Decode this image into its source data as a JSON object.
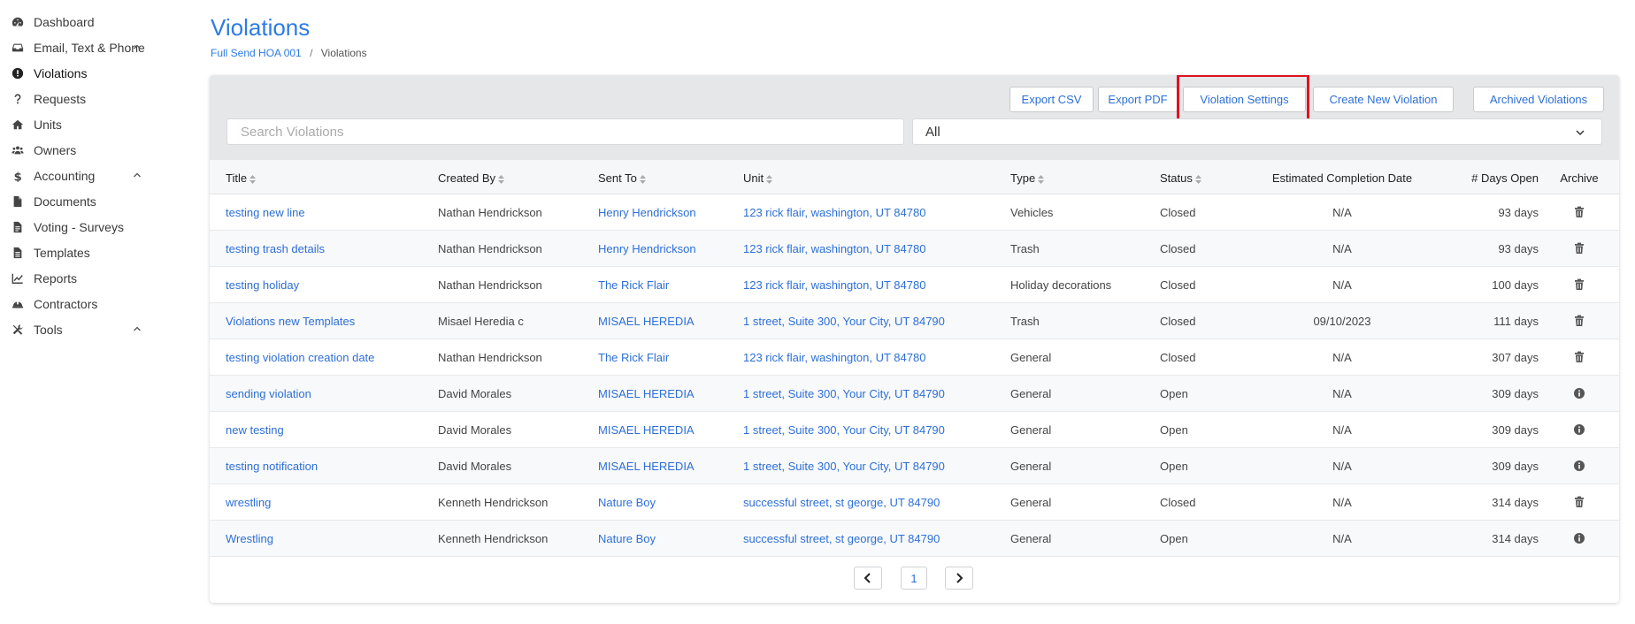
{
  "sidebar": {
    "items": [
      {
        "label": "Dashboard",
        "icon": "dashboard-icon"
      },
      {
        "label": "Email, Text & Phone",
        "icon": "inbox-icon",
        "expandable": true
      },
      {
        "label": "Violations",
        "icon": "exclamation-circle-icon",
        "active": true
      },
      {
        "label": "Requests",
        "icon": "question-icon"
      },
      {
        "label": "Units",
        "icon": "home-icon"
      },
      {
        "label": "Owners",
        "icon": "users-icon"
      },
      {
        "label": "Accounting",
        "icon": "dollar-icon",
        "expandable": true
      },
      {
        "label": "Documents",
        "icon": "file-icon"
      },
      {
        "label": "Voting - Surveys",
        "icon": "file-text-icon"
      },
      {
        "label": "Templates",
        "icon": "file-lines-icon"
      },
      {
        "label": "Reports",
        "icon": "chart-line-icon"
      },
      {
        "label": "Contractors",
        "icon": "hard-hat-icon"
      },
      {
        "label": "Tools",
        "icon": "tools-icon",
        "expandable": true
      }
    ]
  },
  "header": {
    "title": "Violations",
    "breadcrumb": {
      "parent": "Full Send HOA 001",
      "current": "Violations"
    }
  },
  "toolbar": {
    "export_csv": "Export CSV",
    "export_pdf": "Export PDF",
    "violation_settings": "Violation Settings",
    "create_new": "Create New Violation",
    "archived": "Archived Violations",
    "search_placeholder": "Search Violations",
    "filter_value": "All"
  },
  "colors": {
    "accent": "#2d7be5",
    "highlight": "#e0121f"
  },
  "table": {
    "headers": {
      "title": "Title",
      "created_by": "Created By",
      "sent_to": "Sent To",
      "unit": "Unit",
      "type": "Type",
      "status": "Status",
      "est_date": "Estimated Completion Date",
      "days_open": "# Days Open",
      "archive": "Archive"
    },
    "rows": [
      {
        "title": "testing new line",
        "created_by": "Nathan Hendrickson",
        "sent_to": "Henry Hendrickson",
        "unit": "123 rick flair, washington, UT 84780",
        "type": "Vehicles",
        "status": "Closed",
        "est_date": "N/A",
        "days_open": "93 days",
        "archive_icon": "trash-icon"
      },
      {
        "title": "testing trash details",
        "created_by": "Nathan Hendrickson",
        "sent_to": "Henry Hendrickson",
        "unit": "123 rick flair, washington, UT 84780",
        "type": "Trash",
        "status": "Closed",
        "est_date": "N/A",
        "days_open": "93 days",
        "archive_icon": "trash-icon"
      },
      {
        "title": "testing holiday",
        "created_by": "Nathan Hendrickson",
        "sent_to": "The Rick Flair",
        "unit": "123 rick flair, washington, UT 84780",
        "type": "Holiday decorations",
        "status": "Closed",
        "est_date": "N/A",
        "days_open": "100 days",
        "archive_icon": "trash-icon"
      },
      {
        "title": "Violations new Templates",
        "created_by": "Misael Heredia c",
        "sent_to": "MISAEL HEREDIA",
        "unit": "1 street, Suite 300, Your City, UT 84790",
        "type": "Trash",
        "status": "Closed",
        "est_date": "09/10/2023",
        "days_open": "111 days",
        "archive_icon": "trash-icon"
      },
      {
        "title": "testing violation creation date",
        "created_by": "Nathan Hendrickson",
        "sent_to": "The Rick Flair",
        "unit": "123 rick flair, washington, UT 84780",
        "type": "General",
        "status": "Closed",
        "est_date": "N/A",
        "days_open": "307 days",
        "archive_icon": "trash-icon"
      },
      {
        "title": "sending violation",
        "created_by": "David Morales",
        "sent_to": "MISAEL HEREDIA",
        "unit": "1 street, Suite 300, Your City, UT 84790",
        "type": "General",
        "status": "Open",
        "est_date": "N/A",
        "days_open": "309 days",
        "archive_icon": "info-icon"
      },
      {
        "title": "new testing",
        "created_by": "David Morales",
        "sent_to": "MISAEL HEREDIA",
        "unit": "1 street, Suite 300, Your City, UT 84790",
        "type": "General",
        "status": "Open",
        "est_date": "N/A",
        "days_open": "309 days",
        "archive_icon": "info-icon"
      },
      {
        "title": "testing notification",
        "created_by": "David Morales",
        "sent_to": "MISAEL HEREDIA",
        "unit": "1 street, Suite 300, Your City, UT 84790",
        "type": "General",
        "status": "Open",
        "est_date": "N/A",
        "days_open": "309 days",
        "archive_icon": "info-icon"
      },
      {
        "title": "wrestling",
        "created_by": "Kenneth Hendrickson",
        "sent_to": "Nature Boy",
        "unit": "successful street, st george, UT 84790",
        "type": "General",
        "status": "Closed",
        "est_date": "N/A",
        "days_open": "314 days",
        "archive_icon": "trash-icon"
      },
      {
        "title": "Wrestling",
        "created_by": "Kenneth Hendrickson",
        "sent_to": "Nature Boy",
        "unit": "successful street, st george, UT 84790",
        "type": "General",
        "status": "Open",
        "est_date": "N/A",
        "days_open": "314 days",
        "archive_icon": "info-icon"
      }
    ]
  },
  "pagination": {
    "current_page": "1"
  }
}
